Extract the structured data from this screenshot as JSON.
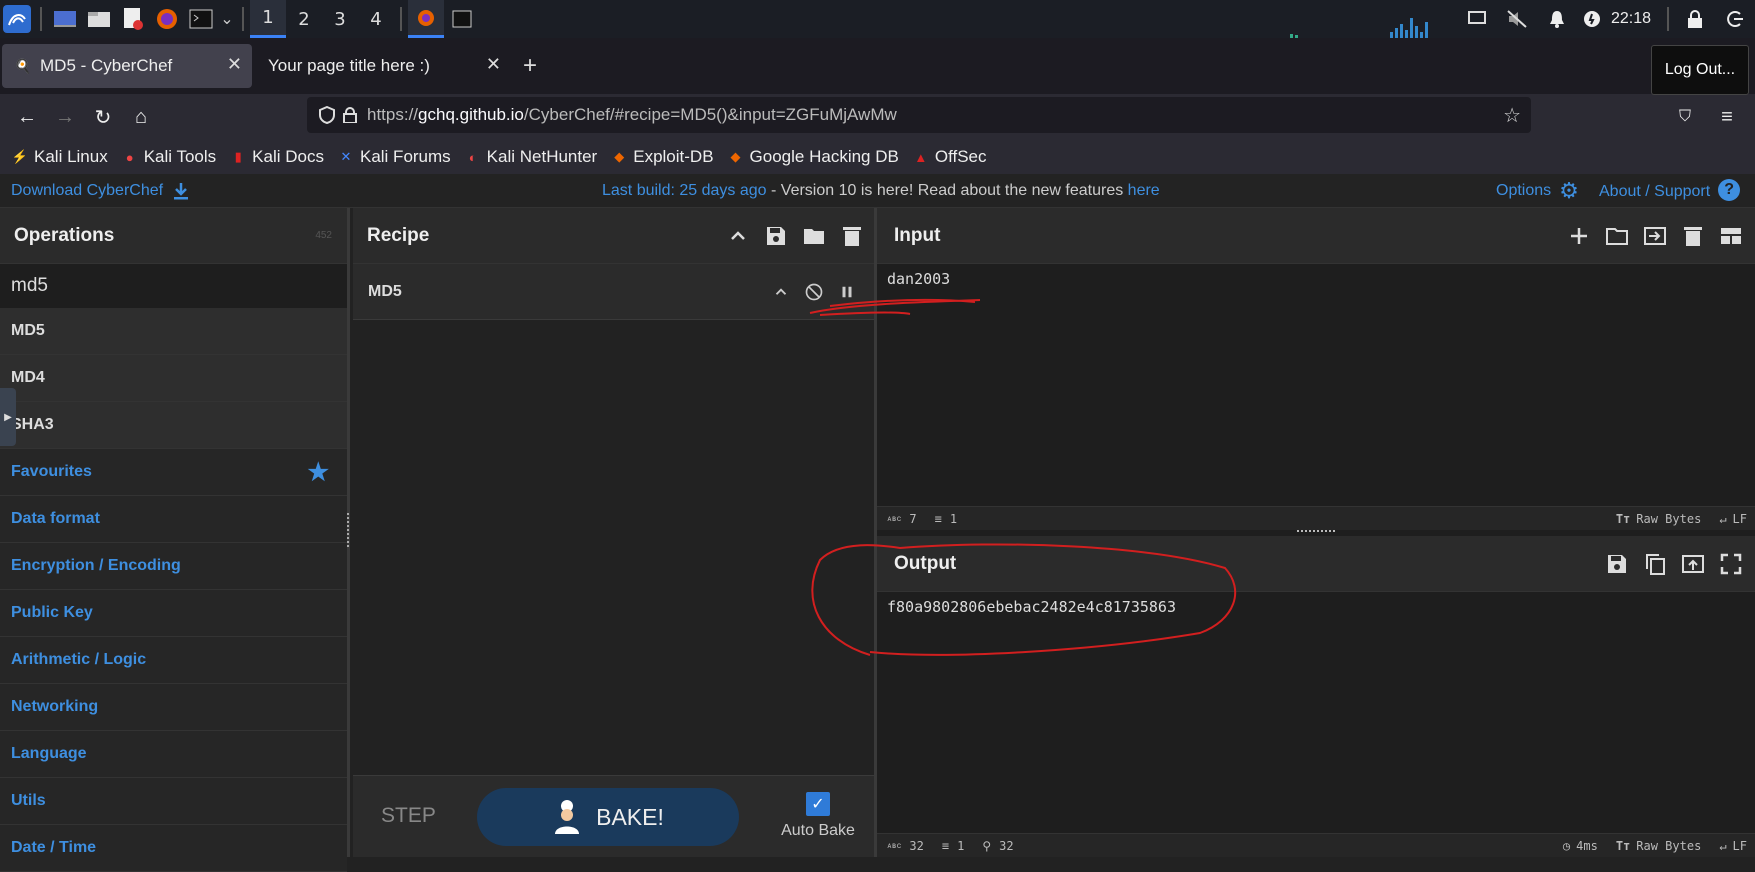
{
  "taskbar": {
    "workspaces": [
      "1",
      "2",
      "3",
      "4"
    ],
    "active_workspace": "1",
    "clock": "22:18"
  },
  "browser": {
    "tabs": [
      {
        "title": "MD5 - CyberChef",
        "active": true
      },
      {
        "title": "Your page title here :)",
        "active": false
      }
    ],
    "url_prefix": "https://",
    "url_host": "gchq.github.io",
    "url_rest": "/CyberChef/#recipe=MD5()&input=ZGFuMjAwMw",
    "bookmarks": [
      "Kali Linux",
      "Kali Tools",
      "Kali Docs",
      "Kali Forums",
      "Kali NetHunter",
      "Exploit-DB",
      "Google Hacking DB",
      "OffSec"
    ],
    "logout_tooltip": "Log Out..."
  },
  "cyberchef": {
    "download": "Download CyberChef",
    "banner_link": "Last build: 25 days ago",
    "banner_text": " - Version 10 is here! Read about the new features ",
    "banner_here": "here",
    "options": "Options",
    "about": "About / Support",
    "operations": {
      "title": "Operations",
      "count": "452",
      "search": "md5",
      "results": [
        "MD5",
        "MD4",
        "SHA3"
      ],
      "categories": [
        "Favourites",
        "Data format",
        "Encryption / Encoding",
        "Public Key",
        "Arithmetic / Logic",
        "Networking",
        "Language",
        "Utils",
        "Date / Time"
      ]
    },
    "recipe": {
      "title": "Recipe",
      "op_name": "MD5",
      "step": "STEP",
      "bake": "BAKE!",
      "autobake": "Auto Bake"
    },
    "input": {
      "title": "Input",
      "value": "dan2003",
      "length": "7",
      "lines": "1",
      "encoding": "Raw Bytes",
      "eol": "LF"
    },
    "output": {
      "title": "Output",
      "value": "f80a9802806ebebac2482e4c81735863",
      "length": "32",
      "lines": "1",
      "pos": "32",
      "time": "4ms",
      "encoding": "Raw Bytes",
      "eol": "LF"
    }
  }
}
